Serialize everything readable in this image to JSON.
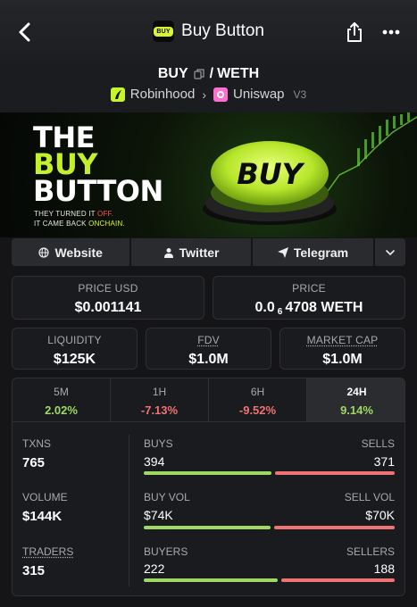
{
  "header": {
    "title": "Buy Button",
    "logo_text": "BUY",
    "icons": [
      "back-icon",
      "share-icon",
      "more-icon"
    ]
  },
  "pair": {
    "base": "BUY",
    "separator": "/",
    "quote": "WETH",
    "chain": "Robinhood",
    "dex": "Uniswap",
    "version": "V3"
  },
  "banner": {
    "line1": "THE",
    "line2": "BUY",
    "line3": "BUTTON",
    "tag1_pre": "THEY TURNED IT",
    "tag1_hl": "OFF.",
    "tag2_pre": "IT CAME BACK",
    "tag2_hl": "ONCHAIN.",
    "button_text": "BUY"
  },
  "links": {
    "website": "Website",
    "twitter": "Twitter",
    "telegram": "Telegram"
  },
  "price": {
    "usd_label": "PRICE USD",
    "usd_value": "$0.001141",
    "native_label": "PRICE",
    "native_prefix": "0.0",
    "native_sub": "6",
    "native_rest": "4708 WETH"
  },
  "metrics": {
    "liquidity_label": "LIQUIDITY",
    "liquidity_value": "$125K",
    "fdv_label": "FDV",
    "fdv_value": "$1.0M",
    "mcap_label": "MARKET CAP",
    "mcap_value": "$1.0M"
  },
  "tabs": [
    {
      "label": "5M",
      "value": "2.02%"
    },
    {
      "label": "1H",
      "value": "-7.13%"
    },
    {
      "label": "6H",
      "value": "-9.52%"
    },
    {
      "label": "24H",
      "value": "9.14%"
    }
  ],
  "stats": {
    "txns_label": "TXNS",
    "txns_value": "765",
    "volume_label": "VOLUME",
    "volume_value": "$144K",
    "traders_label": "TRADERS",
    "traders_value": "315",
    "buys_label": "BUYS",
    "buys_value": "394",
    "sells_label": "SELLS",
    "sells_value": "371",
    "buyvol_label": "BUY VOL",
    "buyvol_value": "$74K",
    "sellvol_label": "SELL VOL",
    "sellvol_value": "$70K",
    "buyers_label": "BUYERS",
    "buyers_value": "222",
    "sellers_label": "SELLERS",
    "sellers_value": "188",
    "buy_share_txns": 0.515,
    "buy_share_vol": 0.514,
    "buy_share_traders": 0.541
  },
  "colors": {
    "positive": "#9fd964",
    "negative": "#f07373",
    "brand": "#c4ef2b"
  }
}
